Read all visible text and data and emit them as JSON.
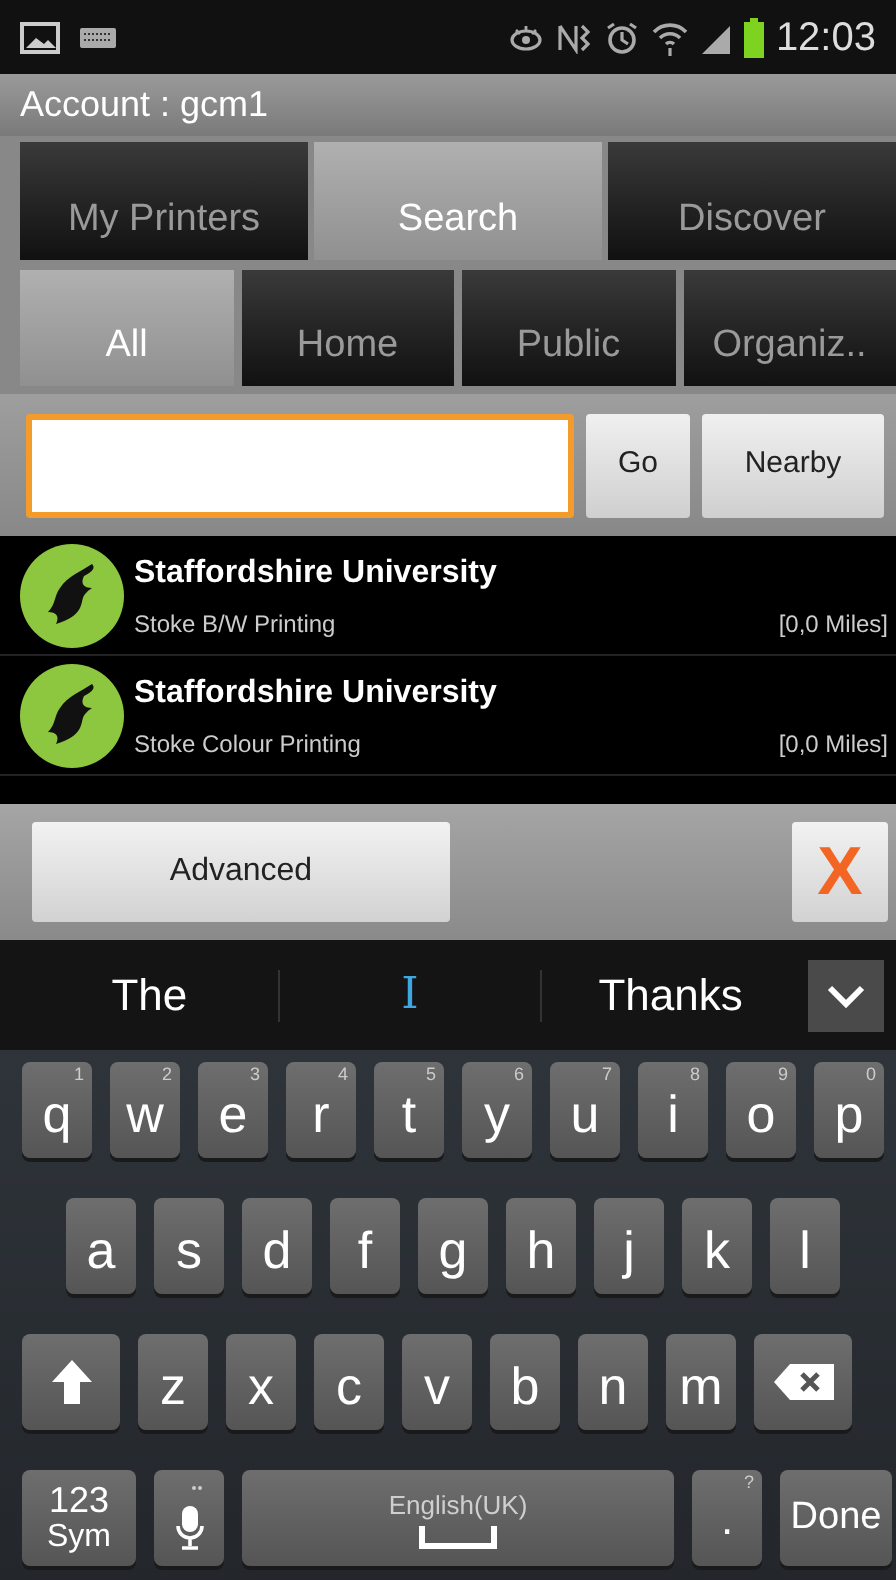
{
  "status_bar": {
    "time": "12:03"
  },
  "account": {
    "label": "Account : gcm1"
  },
  "tabs": [
    {
      "label": "My Printers",
      "selected": false
    },
    {
      "label": "Search",
      "selected": true
    },
    {
      "label": "Discover",
      "selected": false
    }
  ],
  "filters": [
    {
      "label": "All",
      "selected": true
    },
    {
      "label": "Home",
      "selected": false
    },
    {
      "label": "Public",
      "selected": false
    },
    {
      "label": "Organiz..",
      "selected": false
    }
  ],
  "search": {
    "focused": true,
    "go": "Go",
    "nearby": "Nearby"
  },
  "results": [
    {
      "title": "Staffordshire University",
      "subtitle": "Stoke B/W Printing",
      "distance": "[0,0 Miles]"
    },
    {
      "title": "Staffordshire University",
      "subtitle": "Stoke Colour Printing",
      "distance": "[0,0 Miles]"
    }
  ],
  "bottom_bar": {
    "advanced": "Advanced",
    "close": "X"
  },
  "suggestions": [
    {
      "word": "The",
      "selected": false
    },
    {
      "word": "I",
      "selected": true
    },
    {
      "word": "Thanks",
      "selected": false
    }
  ],
  "keyboard": {
    "rows": [
      [
        {
          "kind": "letter",
          "label": "q",
          "hint": "1"
        },
        {
          "kind": "letter",
          "label": "w",
          "hint": "2"
        },
        {
          "kind": "letter",
          "label": "e",
          "hint": "3"
        },
        {
          "kind": "letter",
          "label": "r",
          "hint": "4"
        },
        {
          "kind": "letter",
          "label": "t",
          "hint": "5"
        },
        {
          "kind": "letter",
          "label": "y",
          "hint": "6"
        },
        {
          "kind": "letter",
          "label": "u",
          "hint": "7"
        },
        {
          "kind": "letter",
          "label": "i",
          "hint": "8"
        },
        {
          "kind": "letter",
          "label": "o",
          "hint": "9"
        },
        {
          "kind": "letter",
          "label": "p",
          "hint": "0"
        }
      ],
      [
        {
          "kind": "letter",
          "label": "a"
        },
        {
          "kind": "letter",
          "label": "s"
        },
        {
          "kind": "letter",
          "label": "d"
        },
        {
          "kind": "letter",
          "label": "f"
        },
        {
          "kind": "letter",
          "label": "g"
        },
        {
          "kind": "letter",
          "label": "h"
        },
        {
          "kind": "letter",
          "label": "j"
        },
        {
          "kind": "letter",
          "label": "k"
        },
        {
          "kind": "letter",
          "label": "l"
        }
      ],
      [
        {
          "kind": "shift"
        },
        {
          "kind": "letter",
          "label": "z"
        },
        {
          "kind": "letter",
          "label": "x"
        },
        {
          "kind": "letter",
          "label": "c"
        },
        {
          "kind": "letter",
          "label": "v"
        },
        {
          "kind": "letter",
          "label": "b"
        },
        {
          "kind": "letter",
          "label": "n"
        },
        {
          "kind": "letter",
          "label": "m"
        },
        {
          "kind": "backspace"
        }
      ]
    ],
    "function_keys": [
      {
        "kind": "sym",
        "label": "123",
        "sub": "Sym"
      },
      {
        "kind": "mic"
      },
      {
        "kind": "space",
        "label": "English(UK)"
      },
      {
        "kind": "period",
        "label": ".",
        "hint": "?"
      },
      {
        "kind": "done",
        "label": "Done"
      }
    ]
  }
}
